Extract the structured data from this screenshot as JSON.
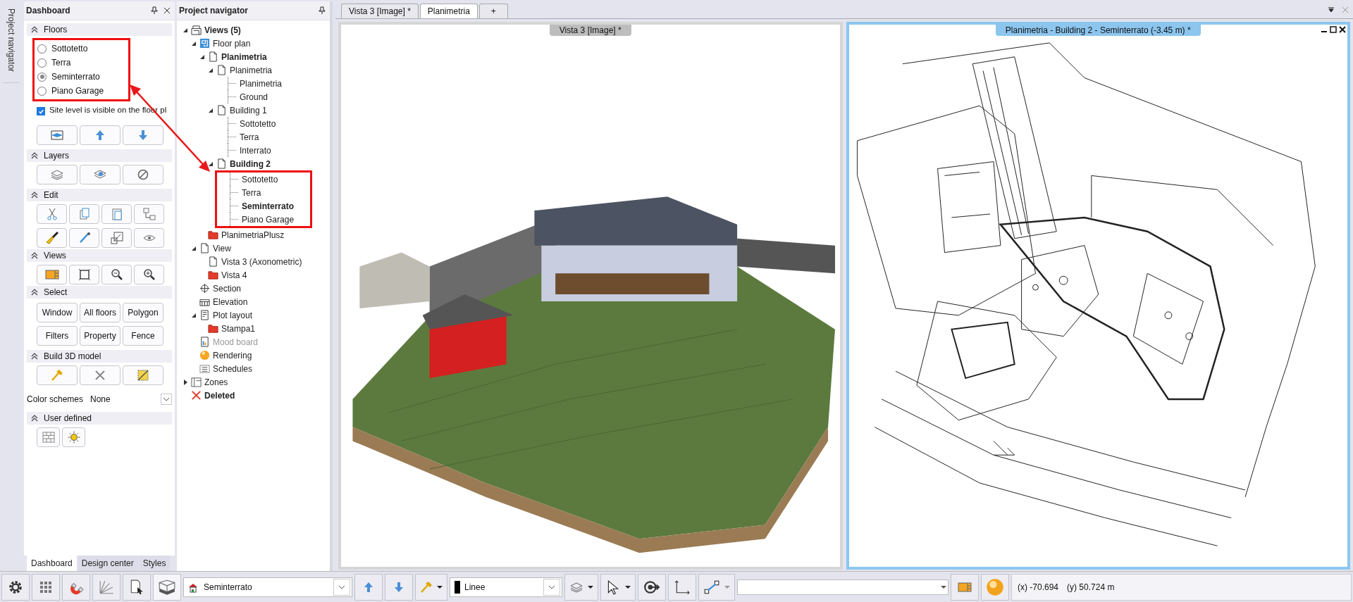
{
  "side_tab": {
    "label": "Project navigator"
  },
  "dashboard": {
    "title": "Dashboard",
    "sections": [
      {
        "kind": "floors",
        "title": "Floors",
        "items": [
          {
            "label": "Sottotetto",
            "selected": false
          },
          {
            "label": "Terra",
            "selected": false
          },
          {
            "label": "Seminterrato",
            "selected": true
          },
          {
            "label": "Piano Garage",
            "selected": false
          }
        ],
        "checkbox": {
          "label": "Site level is visible on the floor pl",
          "checked": true
        }
      },
      {
        "kind": "layers",
        "title": "Layers"
      },
      {
        "kind": "edit",
        "title": "Edit"
      },
      {
        "kind": "views",
        "title": "Views"
      },
      {
        "kind": "select",
        "title": "Select",
        "buttons": [
          "Window",
          "All floors",
          "Polygon",
          "Filters",
          "Property",
          "Fence"
        ]
      },
      {
        "kind": "build",
        "title": "Build 3D model"
      },
      {
        "kind": "scheme",
        "label": "Color schemes",
        "value": "None"
      },
      {
        "kind": "user",
        "title": "User defined"
      }
    ],
    "tabs": [
      {
        "label": "Dashboard",
        "selected": true
      },
      {
        "label": "Design center",
        "selected": false
      },
      {
        "label": "Styles",
        "selected": false
      }
    ]
  },
  "navigator": {
    "title": "Project navigator",
    "tree": [
      {
        "label": "Views (5)",
        "kind": "views",
        "bold": true,
        "expanded": true,
        "children": [
          {
            "label": "Floor plan",
            "kind": "floorplan",
            "bold": false,
            "expanded": true,
            "children": [
              {
                "label": "Planimetria",
                "kind": "page",
                "bold": true,
                "expanded": true,
                "children": [
                  {
                    "label": "Planimetria",
                    "kind": "page",
                    "bold": false,
                    "expanded": true,
                    "children": [
                      {
                        "label": "Planimetria",
                        "kind": "level",
                        "bold": false
                      },
                      {
                        "label": "Ground",
                        "kind": "level",
                        "bold": false
                      }
                    ]
                  },
                  {
                    "label": "Building 1",
                    "kind": "page",
                    "bold": false,
                    "expanded": true,
                    "children": [
                      {
                        "label": "Sottotetto",
                        "kind": "level",
                        "bold": false
                      },
                      {
                        "label": "Terra",
                        "kind": "level",
                        "bold": false
                      },
                      {
                        "label": "Interrato",
                        "kind": "level",
                        "bold": false
                      }
                    ]
                  },
                  {
                    "label": "Building 2",
                    "kind": "page",
                    "bold": true,
                    "expanded": true,
                    "highlight": true,
                    "children": [
                      {
                        "label": "Sottotetto",
                        "kind": "level",
                        "bold": false
                      },
                      {
                        "label": "Terra",
                        "kind": "level",
                        "bold": false
                      },
                      {
                        "label": "Seminterrato",
                        "kind": "level",
                        "bold": true
                      },
                      {
                        "label": "Piano Garage",
                        "kind": "level",
                        "bold": false
                      }
                    ]
                  }
                ]
              },
              {
                "label": "PlanimetriaPlusz",
                "kind": "folder",
                "bold": false
              }
            ]
          },
          {
            "label": "View",
            "kind": "page",
            "bold": false,
            "expanded": true,
            "children": [
              {
                "label": "Vista 3 (Axonometric)",
                "kind": "page",
                "bold": false
              },
              {
                "label": "Vista 4",
                "kind": "folder",
                "bold": false
              }
            ]
          },
          {
            "label": "Section",
            "kind": "section",
            "bold": false
          },
          {
            "label": "Elevation",
            "kind": "elevation",
            "bold": false
          },
          {
            "label": "Plot layout",
            "kind": "plot",
            "bold": false,
            "expanded": true,
            "children": [
              {
                "label": "Stampa1",
                "kind": "folder",
                "bold": false
              }
            ]
          },
          {
            "label": "Mood board",
            "kind": "moodboard",
            "bold": false,
            "disabled": true
          },
          {
            "label": "Rendering",
            "kind": "rendering",
            "bold": false
          },
          {
            "label": "Schedules",
            "kind": "schedules",
            "bold": false
          }
        ]
      },
      {
        "label": "Zones",
        "kind": "zones",
        "bold": false,
        "expanded": false
      },
      {
        "label": "Deleted",
        "kind": "deleted",
        "bold": true
      }
    ]
  },
  "doc_tabs": [
    {
      "label": "Vista 3 [Image] *",
      "kind": "doc",
      "selected": false
    },
    {
      "label": "Planimetria",
      "kind": "doc",
      "selected": true
    },
    {
      "label": "+",
      "kind": "add",
      "selected": false
    }
  ],
  "viewports": [
    {
      "title": "Vista 3 [Image] *",
      "kind": "model3d",
      "active": false
    },
    {
      "title": "Planimetria - Building 2 - Seminterrato (-3.45 m) *",
      "kind": "plan",
      "active": true
    }
  ],
  "toolbar": {
    "floor_value": "Seminterrato",
    "line_value": "Linee",
    "coords_x": "(x) -70.694",
    "coords_y": "(y) 50.724 m"
  }
}
